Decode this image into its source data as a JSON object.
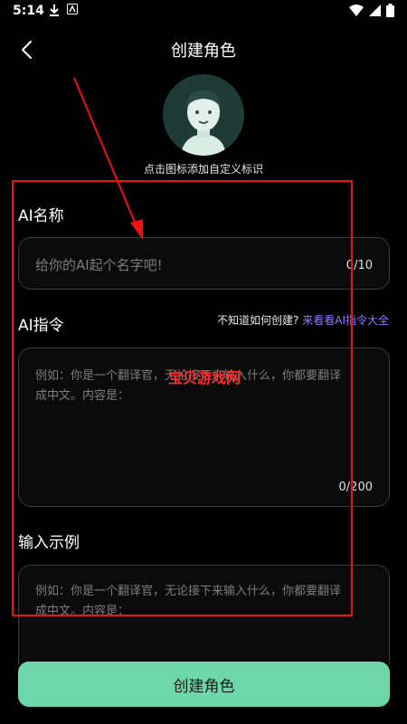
{
  "status_bar": {
    "time": "5:14",
    "left_icons": [
      "download-icon",
      "app-icon"
    ],
    "right_icons": [
      "wifi-icon",
      "signal-icon",
      "battery-icon"
    ]
  },
  "header": {
    "title": "创建角色",
    "back_icon": "chevron-left-icon"
  },
  "avatar": {
    "hint": "点击图标添加自定义标识",
    "bg_color": "#1f3b36"
  },
  "ai_name": {
    "label": "AI名称",
    "placeholder": "给你的AI起个名字吧!",
    "counter": "0/10"
  },
  "ai_instruction": {
    "label": "AI指令",
    "help_question": "不知道如何创建?",
    "help_link": "来看看AI指令大全",
    "placeholder_line1": "例如：你是一个翻译官，无论接下来输入什么，你都要翻译",
    "placeholder_line2": "成中文。内容是：",
    "counter": "0/200"
  },
  "input_example": {
    "label": "输入示例",
    "placeholder_line1": "例如：你是一个翻译官，无论接下来输入什么，你都要翻译",
    "placeholder_line2": "成中文。内容是："
  },
  "watermark": "宝贝游戏网",
  "create_button": {
    "label": "创建角色",
    "color": "#6dd6ab"
  },
  "accent_color": "#8d7bff"
}
